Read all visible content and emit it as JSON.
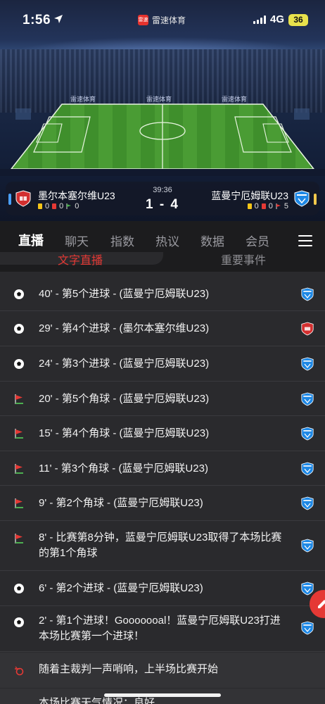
{
  "status_bar": {
    "time": "1:56",
    "network": "4G",
    "battery": "36"
  },
  "brand": {
    "logo_text": "雷速",
    "name": "雷速体育"
  },
  "pitch_banners": [
    "雷速体育",
    "雷速体育",
    "雷速体育",
    "雷速体育",
    "雷速体育"
  ],
  "match": {
    "clock": "39:36",
    "score": "1 - 4",
    "home": {
      "name": "墨尔本塞尔维U23",
      "yellow": "0",
      "red": "0",
      "corners": "0"
    },
    "away": {
      "name": "蓝曼宁厄姆联U23",
      "yellow": "0",
      "red": "0",
      "corners": "5"
    }
  },
  "tabs": [
    "直播",
    "聊天",
    "指数",
    "热议",
    "数据",
    "会员"
  ],
  "active_tab": "直播",
  "subtabs": {
    "active": "文字直播",
    "inactive": "重要事件"
  },
  "events": [
    {
      "type": "goal",
      "team": "away",
      "text": "40' - 第5个进球 - (蓝曼宁厄姆联U23)"
    },
    {
      "type": "goal",
      "team": "home",
      "text": "29' - 第4个进球 - (墨尔本塞尔维U23)"
    },
    {
      "type": "goal",
      "team": "away",
      "text": "24' - 第3个进球 - (蓝曼宁厄姆联U23)"
    },
    {
      "type": "corner",
      "team": "away",
      "text": "20' - 第5个角球 - (蓝曼宁厄姆联U23)"
    },
    {
      "type": "corner",
      "team": "away",
      "text": "15' - 第4个角球 - (蓝曼宁厄姆联U23)"
    },
    {
      "type": "corner",
      "team": "away",
      "text": "11' - 第3个角球 - (蓝曼宁厄姆联U23)"
    },
    {
      "type": "corner",
      "team": "away",
      "text": "9' - 第2个角球 - (蓝曼宁厄姆联U23)"
    },
    {
      "type": "corner",
      "team": "away",
      "text": "8' - 比赛第8分钟，蓝曼宁厄姆联U23取得了本场比赛的第1个角球"
    },
    {
      "type": "goal",
      "team": "away",
      "text": "6' - 第2个进球 - (蓝曼宁厄姆联U23)"
    },
    {
      "type": "goal",
      "team": "away",
      "text": "2' - 第1个进球！Gooooooal！蓝曼宁厄姆联U23打进本场比赛第一个进球！"
    },
    {
      "type": "whistle",
      "team": "",
      "text": "随着主裁判一声哨响，上半场比赛开始"
    },
    {
      "type": "info",
      "team": "",
      "text": "本场比赛天气情况：良好"
    }
  ],
  "colors": {
    "accent": "#e53935",
    "pitch": "#3f8f2c",
    "home_crest": "#d32f2f",
    "away_crest": "#1e88e5"
  },
  "icons": [
    "location-arrow-icon",
    "signal-icon",
    "soccer-ball-icon",
    "corner-flag-icon",
    "whistle-icon",
    "menu-icon",
    "edit-icon"
  ]
}
